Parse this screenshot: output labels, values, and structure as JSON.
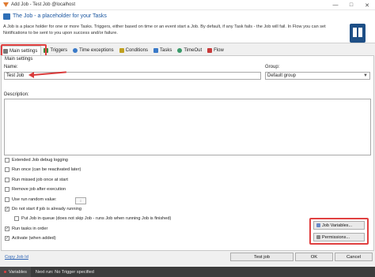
{
  "window": {
    "title": "Add Job - Test Job @localhost",
    "controls": {
      "minimize": "—",
      "maximize": "□",
      "close": "✕"
    }
  },
  "header": {
    "title": "The Job - a placeholder for your Tasks",
    "description": "A Job is a place holder for one or more Tasks. Triggers, either based on time or an event start a Job. By default, if any Task fails - the Job will fail. In Flow you can set Notifications to be sent to you upon success and/or failure."
  },
  "tabs": [
    {
      "label": "Main settings",
      "icon": "gear-icon",
      "color": "#7a7a7a"
    },
    {
      "label": "Triggers",
      "icon": "triggers-icon",
      "color": "#3a8a3a"
    },
    {
      "label": "Time exceptions",
      "icon": "clock-icon",
      "color": "#3a7ac8"
    },
    {
      "label": "Conditions",
      "icon": "conditions-icon",
      "color": "#c0a020"
    },
    {
      "label": "Tasks",
      "icon": "tasks-icon",
      "color": "#3a7ac8"
    },
    {
      "label": "TimeOut",
      "icon": "timeout-icon",
      "color": "#3a9a6a"
    },
    {
      "label": "Flow",
      "icon": "flow-icon",
      "color": "#c83a3a"
    }
  ],
  "main": {
    "group_title": "Main settings",
    "name_label": "Name:",
    "name_value": "Test Job",
    "group_label": "Group:",
    "group_value": "Default group",
    "description_label": "Description:"
  },
  "options": [
    {
      "label": "Extended Job debug logging",
      "checked": false
    },
    {
      "label": "Run once (can be reactivated later)",
      "checked": false
    },
    {
      "label": "Run missed job once at start",
      "checked": false
    },
    {
      "label": "Remove job after execution",
      "checked": false
    },
    {
      "label": "Use run random value:",
      "checked": false
    },
    {
      "label": "Do not start if job is already running",
      "checked": true
    },
    {
      "label": "Put Job in queue (does not skip Job - runs Job when running Job is finished)",
      "checked": false
    },
    {
      "label": "Run tasks in order",
      "checked": true
    },
    {
      "label": "Activate (when added)",
      "checked": true
    }
  ],
  "side_buttons": {
    "job_variables": "Job Variables...",
    "permissions": "Permissions..."
  },
  "footer": {
    "copy_link": "Copy Job Id",
    "test_job": "Test job",
    "ok": "OK",
    "cancel": "Cancel"
  },
  "status": {
    "variables": "Variables",
    "next_run": "Next run: No Trigger specified"
  },
  "colors": {
    "accent": "#1a56a0",
    "highlight": "#e04040",
    "statusbar": "#3c3c3c"
  }
}
